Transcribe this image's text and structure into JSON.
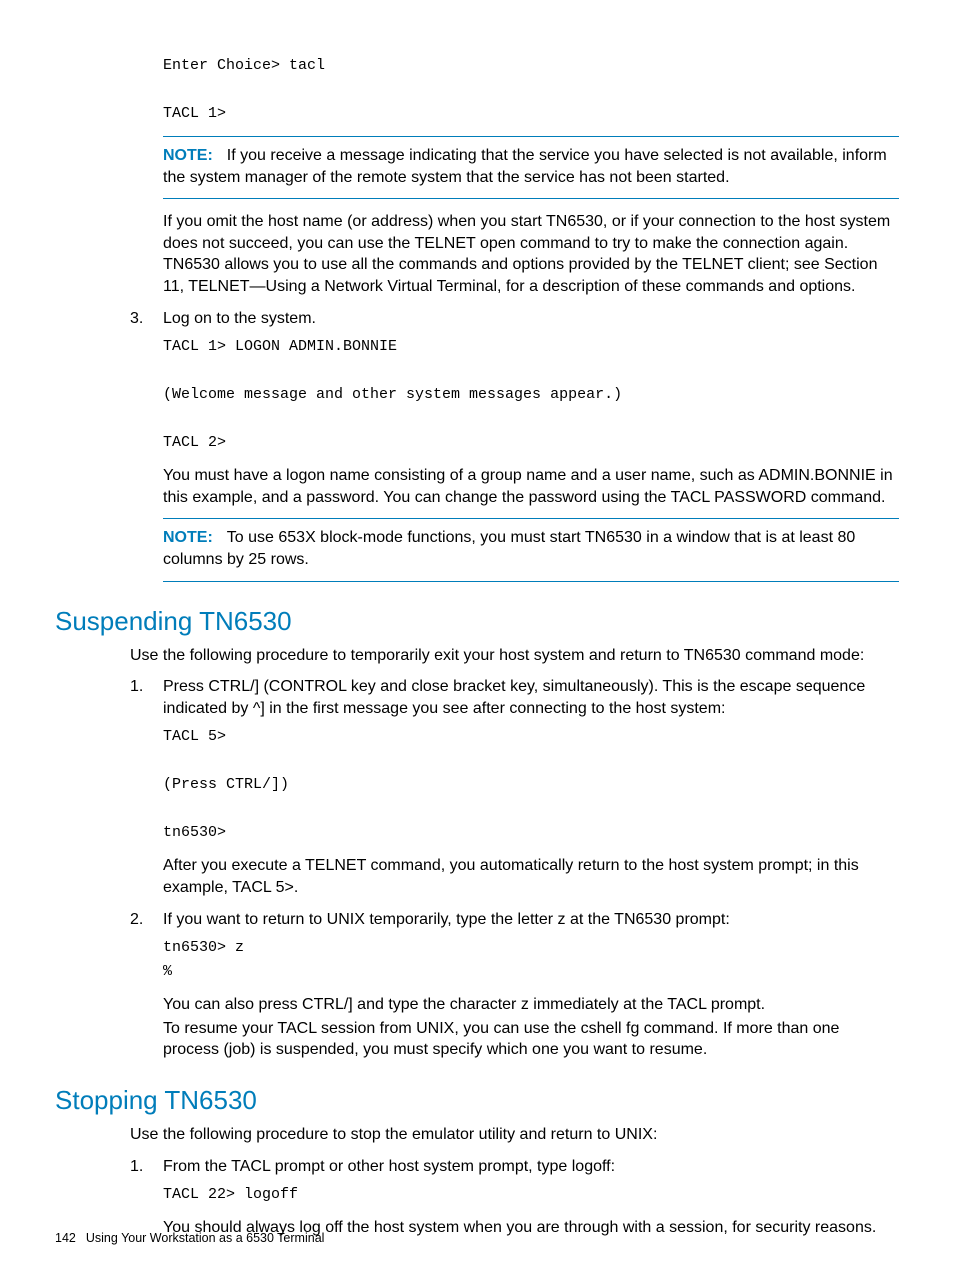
{
  "top_code": "Enter Choice> tacl\n\nTACL 1>",
  "note1": {
    "label": "NOTE:",
    "text": "If you receive a message indicating that the service you have selected is not available, inform the system manager of the remote system that the service has not been started."
  },
  "para_omit": "If you omit the host name (or address) when you start TN6530, or if your connection to the host system does not succeed, you can use the TELNET open command to try to make the connection again. TN6530 allows you to use all the commands and options provided by the TELNET client; see Section 11, TELNET—Using a Network Virtual Terminal, for a description of these commands and options.",
  "step3": {
    "num": "3.",
    "text": "Log on to the system.",
    "code": "TACL 1> LOGON ADMIN.BONNIE\n\n(Welcome message and other system messages appear.)\n\nTACL 2>",
    "after": "You must have a logon name consisting of a group name and a user name, such as ADMIN.BONNIE in this example, and a password. You can change the password using the TACL PASSWORD command."
  },
  "note2": {
    "label": "NOTE:",
    "text": "To use 653X block-mode functions, you must start TN6530 in a window that is at least 80 columns by 25 rows."
  },
  "suspend": {
    "heading": "Suspending TN6530",
    "intro": "Use the following procedure to temporarily exit your host system and return to TN6530 command mode:",
    "s1": {
      "num": "1.",
      "text": "Press CTRL/] (CONTROL key and close bracket key, simultaneously). This is the escape sequence indicated by ^] in the first message you see after connecting to the host system:",
      "code": "TACL 5>\n\n(Press CTRL/])\n\ntn6530>",
      "after": "After you execute a TELNET command, you automatically return to the host system prompt; in this example, TACL 5>."
    },
    "s2": {
      "num": "2.",
      "text": "If you want to return to UNIX temporarily, type the letter z at the TN6530 prompt:",
      "code": "tn6530> z\n%",
      "after1": "You can also press CTRL/] and type the character z immediately at the TACL prompt.",
      "after2": "To resume your TACL session from UNIX, you can use the cshell fg command. If more than one process (job) is suspended, you must specify which one you want to resume."
    }
  },
  "stop": {
    "heading": "Stopping TN6530",
    "intro": "Use the following procedure to stop the emulator utility and return to UNIX:",
    "s1": {
      "num": "1.",
      "text": "From the TACL prompt or other host system prompt, type logoff:",
      "code": "TACL 22> logoff",
      "after": "You should always log off the host system when you are through with a session, for security reasons."
    }
  },
  "footer": {
    "page": "142",
    "title": "Using Your Workstation as a 6530 Terminal"
  }
}
